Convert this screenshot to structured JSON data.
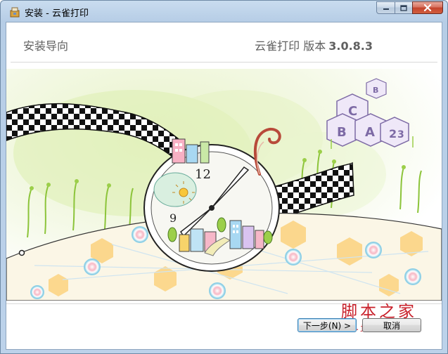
{
  "window": {
    "title": "安装 - 云雀打印"
  },
  "header": {
    "title": "安装导向",
    "version_label": "云雀打印 版本",
    "version_number": "3.0.8.3"
  },
  "buttons": {
    "next_label": "下一步(N) >",
    "cancel_label": "取消"
  },
  "watermark": {
    "main": "脚本之家",
    "sub": "www.jb51.net"
  },
  "banner": {
    "cube_letters": [
      "C",
      "B",
      "A",
      "2",
      "3",
      "B"
    ],
    "clock_numbers": [
      "12",
      "9"
    ]
  },
  "colors": {
    "title_bar": "#bcd2ea",
    "close_button": "#c3432c",
    "watermark": "#c8202a"
  }
}
